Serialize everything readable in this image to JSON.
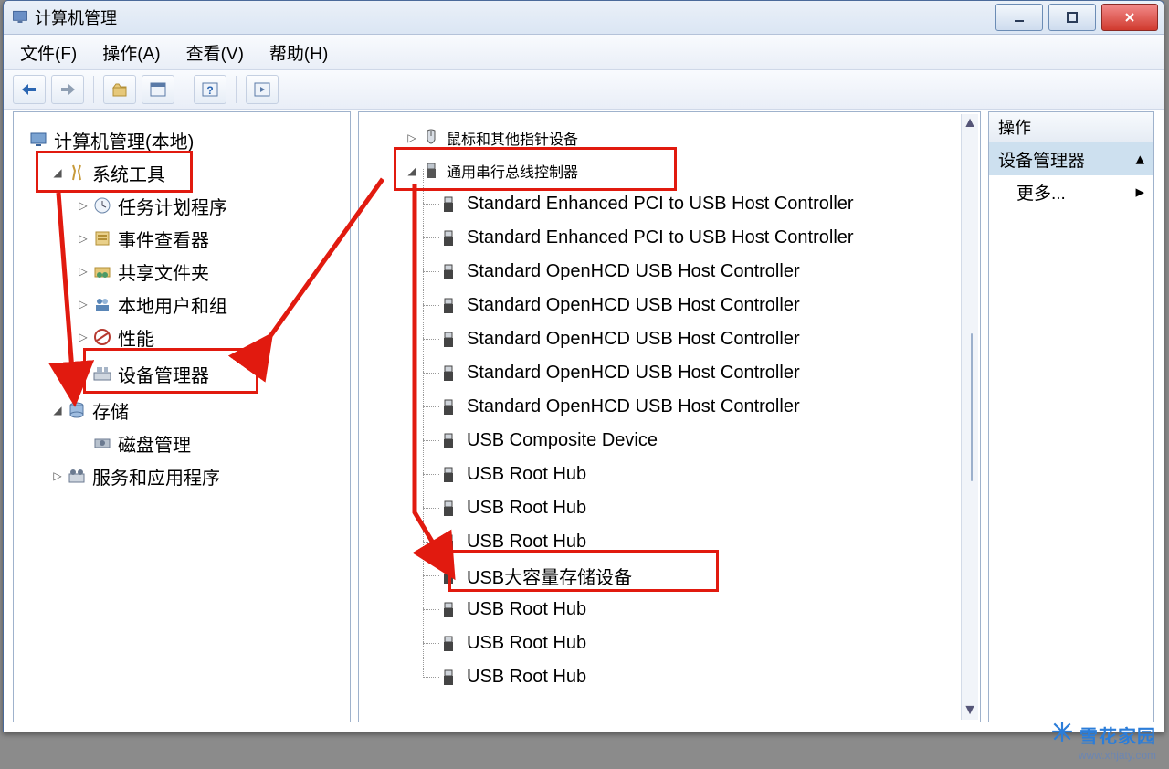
{
  "window": {
    "title": "计算机管理"
  },
  "menu": {
    "file": "文件(F)",
    "action": "操作(A)",
    "view": "查看(V)",
    "help": "帮助(H)"
  },
  "left_tree": {
    "root": "计算机管理(本地)",
    "system_tools": "系统工具",
    "task_scheduler": "任务计划程序",
    "event_viewer": "事件查看器",
    "shared_folders": "共享文件夹",
    "local_users": "本地用户和组",
    "performance": "性能",
    "device_manager": "设备管理器",
    "storage": "存储",
    "disk_management": "磁盘管理",
    "services_apps": "服务和应用程序"
  },
  "center": {
    "mouse": "鼠标和其他指针设备",
    "usb_controllers": "通用串行总线控制器",
    "items": [
      "Standard Enhanced PCI to USB Host Controller",
      "Standard Enhanced PCI to USB Host Controller",
      "Standard OpenHCD USB Host Controller",
      "Standard OpenHCD USB Host Controller",
      "Standard OpenHCD USB Host Controller",
      "Standard OpenHCD USB Host Controller",
      "Standard OpenHCD USB Host Controller",
      "USB Composite Device",
      "USB Root Hub",
      "USB Root Hub",
      "USB Root Hub",
      "USB大容量存储设备",
      "USB Root Hub",
      "USB Root Hub",
      "USB Root Hub"
    ]
  },
  "right_panel": {
    "header": "操作",
    "selected": "设备管理器",
    "more": "更多..."
  },
  "watermark": {
    "line1": "雪花家园",
    "line2": "www.xhjaty.com"
  }
}
